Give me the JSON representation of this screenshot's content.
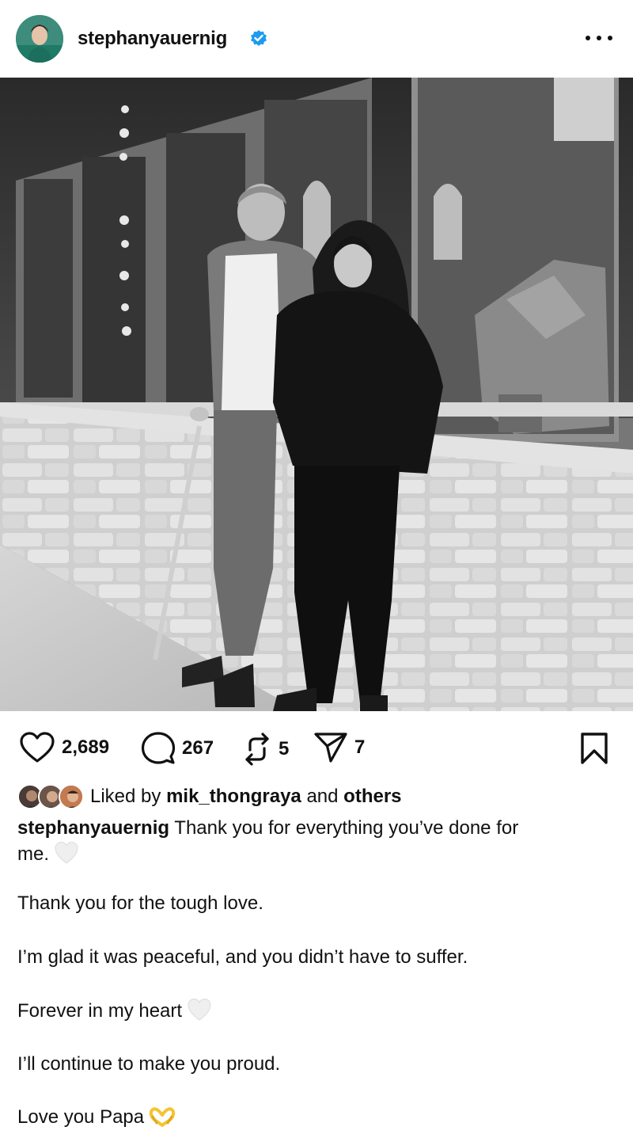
{
  "post": {
    "username": "stephanyauernig",
    "verified": true,
    "menu_icon": "more-horizontal-icon"
  },
  "actions": {
    "likes": "2,689",
    "comments": "267",
    "reposts": "5",
    "shares": "7"
  },
  "liked_by": {
    "prefix": "Liked by",
    "user": "mik_thongraya",
    "and": "and",
    "others": "others"
  },
  "caption": {
    "username": "stephanyauernig",
    "line1": "Thank you for everything you’ve done for",
    "line1b": "me.",
    "p2": "Thank you for the tough love.",
    "p3": "I’m glad it was peaceful, and you didn’t have to suffer.",
    "p4": "Forever in my heart",
    "p5": "I’ll continue to make you proud.",
    "p6": "Love you Papa"
  },
  "colors": {
    "verified_blue": "#1d9bf0",
    "text": "#111111",
    "white_heart": "#eeeeee",
    "heart_hands": "#f4c430"
  }
}
